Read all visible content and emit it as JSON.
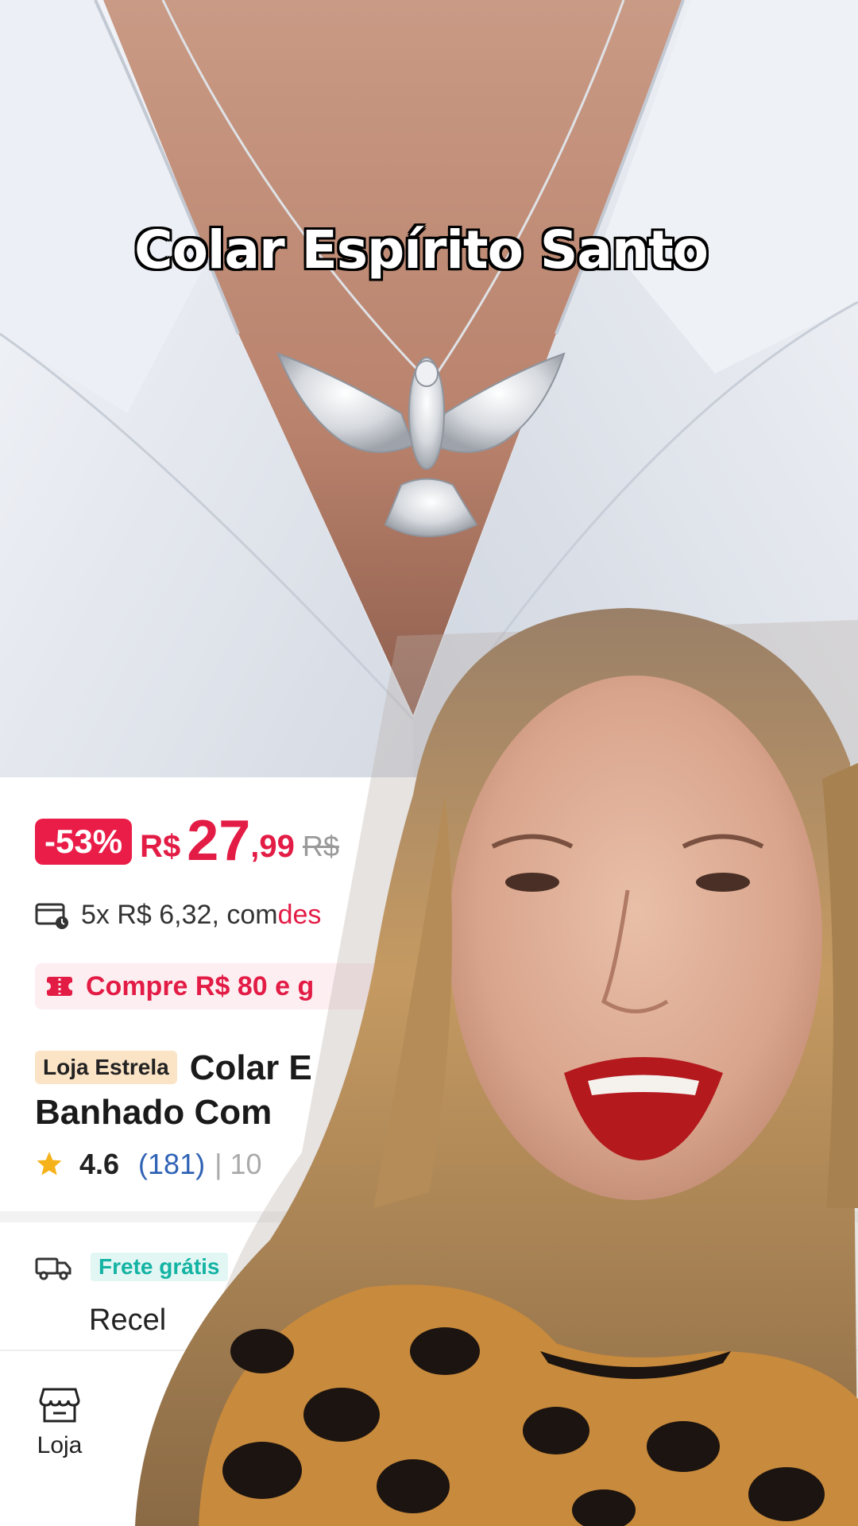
{
  "overlay": {
    "caption": "Colar Espírito Santo"
  },
  "product": {
    "discount_badge": "-53%",
    "currency": "R$",
    "price_int": "27",
    "price_dec": ",99",
    "old_price": "R$",
    "installments_prefix": "5x R$ 6,32, com ",
    "installments_highlight": "des",
    "promo_text": "Compre R$ 80 e g",
    "store_badge": "Loja Estrela",
    "title_line1": "Colar E",
    "title_line2": "Banhado Com",
    "rating": "4.6",
    "review_count": "(181)",
    "sold_text": "| 10",
    "shipping_badge": "Frete grátis",
    "shipping_text": "Recel"
  },
  "bottom_nav": {
    "store_label": "Loja"
  },
  "colors": {
    "accent_red": "#e31c46",
    "discount_bg": "#ea1d48",
    "link_blue": "#2f63b5",
    "shipping_teal": "#14b3a3",
    "store_badge_bg": "#fbe3c5"
  }
}
